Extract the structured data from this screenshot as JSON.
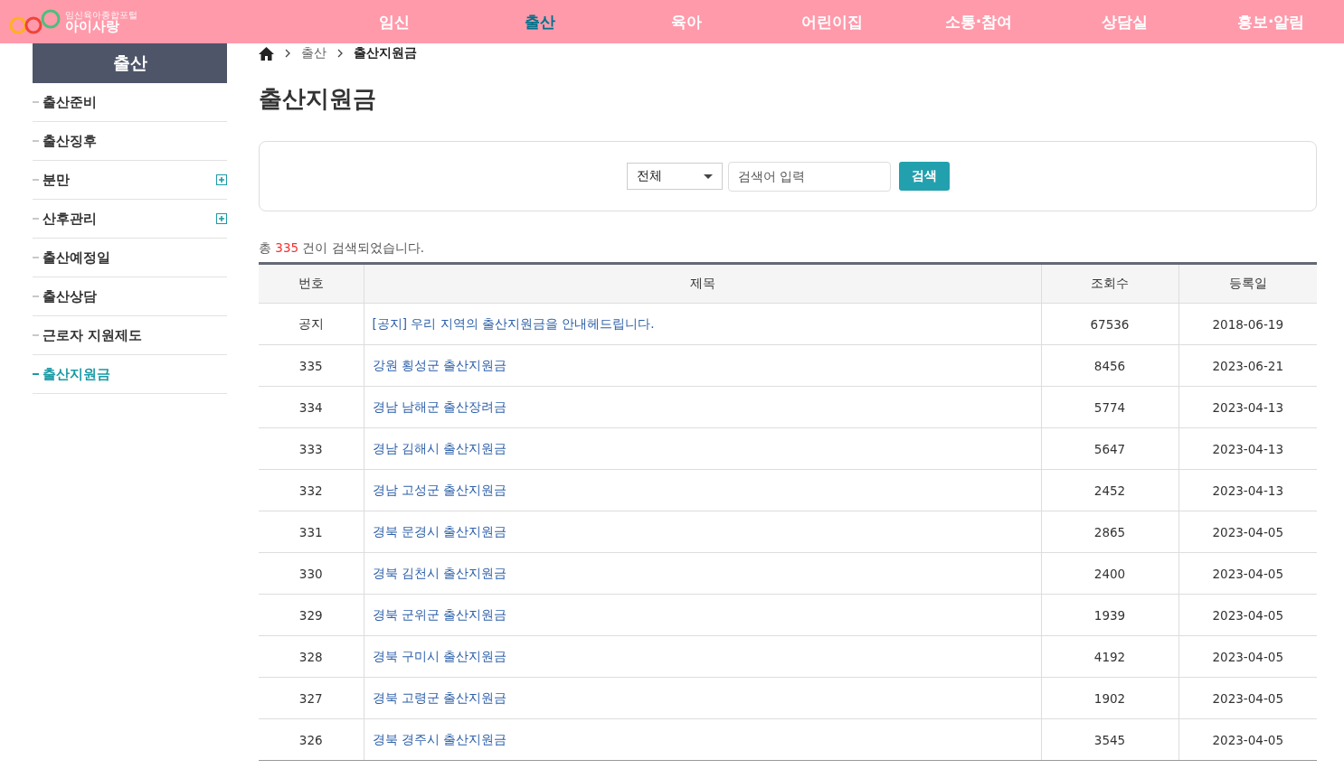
{
  "header": {
    "logo_tagline": "임신육아종합포털",
    "logo_name": "아이사랑",
    "nav": [
      {
        "label": "임신",
        "selected": false
      },
      {
        "label": "출산",
        "selected": true
      },
      {
        "label": "육아",
        "selected": false
      },
      {
        "label": "어린이집",
        "selected": false
      },
      {
        "label": "소통·참여",
        "selected": false
      },
      {
        "label": "상담실",
        "selected": false
      },
      {
        "label": "홍보·알림",
        "selected": false
      }
    ]
  },
  "sidebar": {
    "title": "출산",
    "items": [
      {
        "label": "출산준비",
        "selected": false,
        "expandable": false
      },
      {
        "label": "출산징후",
        "selected": false,
        "expandable": false
      },
      {
        "label": "분만",
        "selected": false,
        "expandable": true
      },
      {
        "label": "산후관리",
        "selected": false,
        "expandable": true
      },
      {
        "label": "출산예정일",
        "selected": false,
        "expandable": false
      },
      {
        "label": "출산상담",
        "selected": false,
        "expandable": false
      },
      {
        "label": "근로자 지원제도",
        "selected": false,
        "expandable": false
      },
      {
        "label": "출산지원금",
        "selected": true,
        "expandable": false
      }
    ]
  },
  "breadcrumb": [
    "출산",
    "출산지원금"
  ],
  "page_title": "출산지원금",
  "search": {
    "category": "전체",
    "placeholder": "검색어 입력",
    "button": "검색"
  },
  "result_summary": {
    "before": "총",
    "count": "335",
    "after": "건이 검색되었습니다."
  },
  "table": {
    "columns": [
      "번호",
      "제목",
      "조회수",
      "등록일"
    ],
    "rows": [
      [
        "공지",
        "[공지] 우리 지역의 출산지원금을 안내헤드립니다.",
        "67536",
        "2018-06-19"
      ],
      [
        "335",
        "강원 횡성군 출산지원금",
        "8456",
        "2023-06-21"
      ],
      [
        "334",
        "경남 남해군 출산장려금",
        "5774",
        "2023-04-13"
      ],
      [
        "333",
        "경남 김해시 출산지원금",
        "5647",
        "2023-04-13"
      ],
      [
        "332",
        "경남 고성군 출산지원금",
        "2452",
        "2023-04-13"
      ],
      [
        "331",
        "경북 문경시 출산지원금",
        "2865",
        "2023-04-05"
      ],
      [
        "330",
        "경북 김천시 출산지원금",
        "2400",
        "2023-04-05"
      ],
      [
        "329",
        "경북 군위군 출산지원금",
        "1939",
        "2023-04-05"
      ],
      [
        "328",
        "경북 구미시 출산지원금",
        "4192",
        "2023-04-05"
      ],
      [
        "327",
        "경북 고령군 출산지원금",
        "1902",
        "2023-04-05"
      ],
      [
        "326",
        "경북 경주시 출산지원금",
        "3545",
        "2023-04-05"
      ]
    ]
  }
}
